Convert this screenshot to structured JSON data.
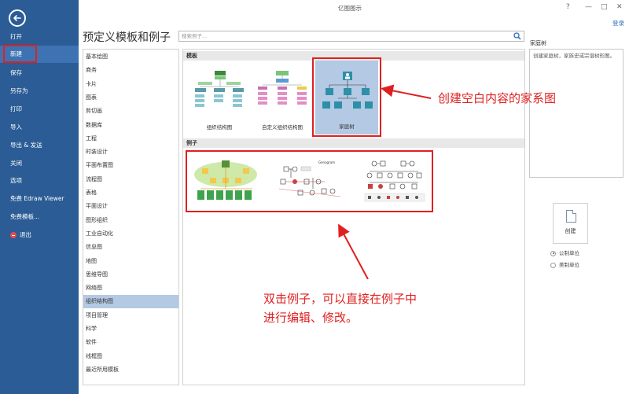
{
  "window": {
    "title": "亿图图示",
    "controls": [
      "?",
      "—",
      "□",
      "✕"
    ],
    "login": "登录"
  },
  "sidebar": {
    "items": [
      {
        "label": "打开"
      },
      {
        "label": "新建"
      },
      {
        "label": "保存"
      },
      {
        "label": "另存为"
      },
      {
        "label": "打印"
      },
      {
        "label": "导入"
      },
      {
        "label": "导出 & 发送"
      },
      {
        "label": "关闭"
      },
      {
        "label": "选项"
      },
      {
        "label": "免费 Edraw Viewer"
      },
      {
        "label": "免费模板..."
      },
      {
        "label": "退出"
      }
    ]
  },
  "heading": "预定义模板和例子",
  "search": {
    "placeholder": "搜索例子..."
  },
  "categories": [
    "基本绘图",
    "商务",
    "卡片",
    "图表",
    "剪切画",
    "数据库",
    "工程",
    "时装设计",
    "平面布置图",
    "流程图",
    "表格",
    "平面设计",
    "图形组织",
    "工业自动化",
    "信息图",
    "地图",
    "思维导图",
    "网络图",
    "组织结构图",
    "项目管理",
    "科学",
    "软件",
    "线框图",
    "最近所用模板"
  ],
  "main": {
    "templates_header": "模板",
    "examples_header": "例子",
    "templates": [
      {
        "label": "组织结构图"
      },
      {
        "label": "自定义组织结构图"
      },
      {
        "label": "家庭树"
      }
    ],
    "example_title_small": "Genogram"
  },
  "right_panel": {
    "title": "家庭树",
    "description": "创建家庭树，家族史或宗谱树形图。",
    "create_label": "创建",
    "units": [
      {
        "label": "公制单位",
        "checked": true
      },
      {
        "label": "美制单位",
        "checked": false
      }
    ]
  },
  "annotations": {
    "top": "创建空白内容的家系图",
    "bottom_line1": "双击例子，可以直接在例子中",
    "bottom_line2": "进行编辑、修改。"
  }
}
